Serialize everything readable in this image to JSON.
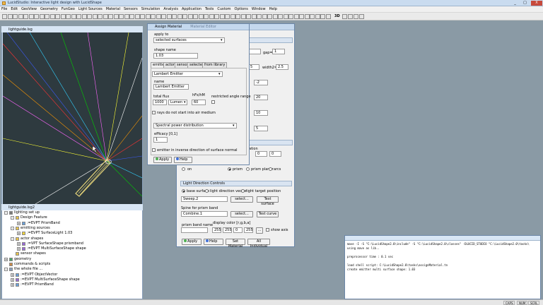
{
  "app": {
    "title": "LucidStudio: Interactive light design with LucidShape",
    "window_controls": [
      "_",
      "□",
      "X"
    ]
  },
  "menu": [
    "File",
    "Edit",
    "GeoView",
    "Geometry",
    "FunGeo",
    "Light Sources",
    "Material",
    "Sensors",
    "Simulation",
    "Analysis",
    "Application",
    "Tests",
    "Custom",
    "Options",
    "Window",
    "Help"
  ],
  "toolbar": {
    "label_3d": "3D"
  },
  "viewport": {
    "title": "lightguide.lsg",
    "ray_colors": [
      "#ff3333",
      "#3d5cff",
      "#33d1ff",
      "#00d100",
      "#ff66ff",
      "#ffff33",
      "#ffffff",
      "#ff9900"
    ],
    "guide_color": "#e0d078"
  },
  "tree": {
    "title": "lightguide.lsg2",
    "items": [
      {
        "text": "lighting set up",
        "level": 0,
        "expand": "-",
        "icon": "gear-icon"
      },
      {
        "text": "Design Feature",
        "level": 1,
        "expand": "-",
        "icon": "folder-icon"
      },
      {
        "text": ":=EVPT PrismBand",
        "level": 2,
        "expand": "+",
        "icon": "object-icon"
      },
      {
        "text": "emitting sources",
        "level": 1,
        "expand": "-",
        "icon": "folder-icon"
      },
      {
        "text": ":=EVPT SurfaceLight   1.03",
        "level": 2,
        "expand": "+",
        "icon": "light-icon"
      },
      {
        "text": "actor shapes",
        "level": 1,
        "expand": "-",
        "icon": "folder-icon"
      },
      {
        "text": ":=VPT SurfaceShape   prismband",
        "level": 2,
        "expand": "+",
        "icon": "shape-icon"
      },
      {
        "text": ":=EVPT MultiSurfaceShape   shape",
        "level": 2,
        "expand": "+",
        "icon": "shape-icon"
      },
      {
        "text": "sensor shapes",
        "level": 1,
        "expand": "",
        "icon": "folder-icon"
      },
      {
        "text": "geometry",
        "level": 0,
        "expand": "+",
        "icon": "geometry-icon"
      },
      {
        "text": "commands & scripts",
        "level": 0,
        "expand": "",
        "icon": "script-icon"
      },
      {
        "text": "the whole file ...",
        "level": 0,
        "expand": "-",
        "icon": "file-icon"
      },
      {
        "text": ":=EVPT ObjectVector",
        "level": 1,
        "expand": "+",
        "icon": "object-icon"
      },
      {
        "text": ":=EVPT MultiSurfaceShape   shape",
        "level": 1,
        "expand": "+",
        "icon": "shape-icon"
      },
      {
        "text": ":=EVPT PrismBand",
        "level": 1,
        "expand": "+",
        "icon": "object-icon"
      }
    ]
  },
  "assign_material": {
    "title": "Assign Material",
    "title_right": "Material Editor",
    "apply_to_label": "apply to",
    "apply_to_value": "selected surfaces",
    "shape_name_label": "shape name",
    "shape_name_value": "1.03",
    "tabs": [
      "emitter",
      "actor",
      "sensor",
      "selected",
      "from library"
    ],
    "emitter_type": "Lambert Emitter",
    "name_label": "name",
    "name_value": "Lambert Emitter",
    "total_flux_label": "total flux",
    "total_flux_value": "1000",
    "unit_value": "Lumen",
    "hm_label": "hFs/hM",
    "hm_value": "60",
    "restricted_label": "restricted angle range",
    "rays_label": "rays do not start into air medium",
    "spectral_value": "Spectral power distribution",
    "efficacy_label": "efficacy [0,1]",
    "efficacy_value": "1",
    "inverse_label": "emitter in inverse direction of surface normal",
    "apply_btn": "Apply",
    "help_btn": "Help"
  },
  "back_dialog": {
    "gap_label": "gap=",
    "gap_value": "1",
    "val_a": "5",
    "width2_label": "width2=",
    "width2_value": "2.5",
    "val_b": "-2",
    "val_c": "20",
    "val_d": "10",
    "val_e": "5",
    "ation_label": "ation",
    "val_f": "0",
    "val_g": "0",
    "radio_on": "on",
    "radio_prism": "prism",
    "radio_prism_planar": "prism planar",
    "radio_arcs": "arcs",
    "ldc_title": "Light Direction Controls",
    "ldc_opt1": "base surface",
    "ldc_opt2": "light direction vector",
    "ldc_opt3": "light target position",
    "sweep_value": "Sweep.2",
    "select_btn": "select...",
    "test_surface_btn": "Test surface",
    "spine_label": "Spine for prism band",
    "combine_value": "Combine.1",
    "test_curve_btn": "Test curve",
    "prism_band_label": "prism band name",
    "display_color_label": "display color [r,g,b,a]",
    "color_values": [
      "255",
      "255",
      "0",
      "255"
    ],
    "dots_btn": "...",
    "show_axis_label": "show axis",
    "apply_btn": "Apply",
    "help_btn": "Help",
    "set_material_btn": "Set Material",
    "all_individual_btn": "All Individual"
  },
  "console": {
    "lines": [
      "mave -I   -S \"C:\\LucidShape2.0\\include\" -S \"C:\\LucidShape2.0\\classes\" -DLUCID_STUDIO  \"C:\\LucidShape2.0\\tasks\\",
      "using mave as lib..",
      "",
      " preprocessor time : 0.1 sec",
      "",
      "load shell script: C:\\LucidShape2.0\\tasks\\assignMaterial.tn",
      "create emitter multi surface shape:  1.03"
    ]
  },
  "status": {
    "caps": "CAPS",
    "num": "NUM",
    "scrl": "SCRL"
  }
}
